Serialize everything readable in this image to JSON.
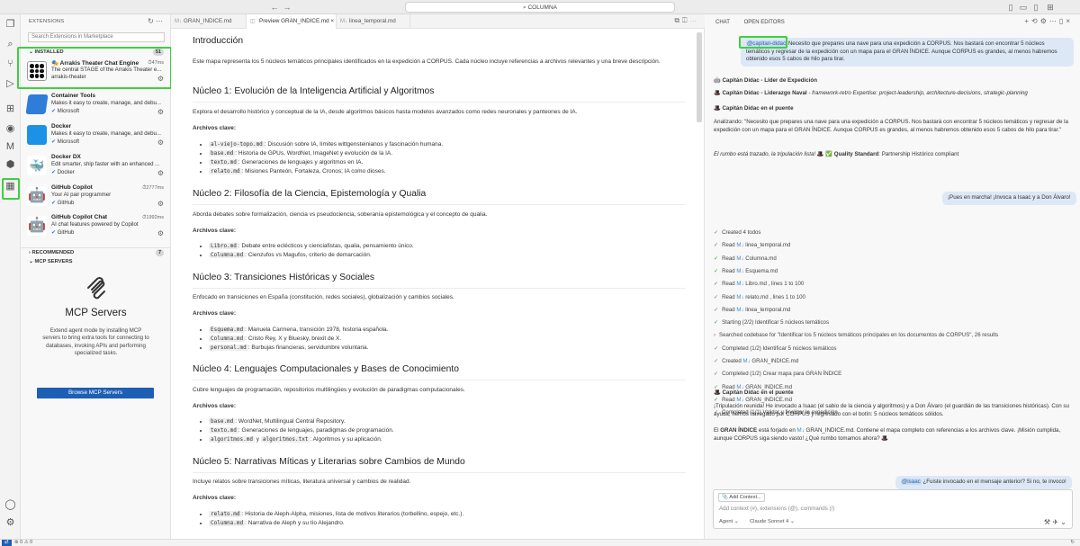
{
  "titlebar": {
    "search": "COLUMNA"
  },
  "sidebar": {
    "title": "EXTENSIONS",
    "search_placeholder": "Search Extensions in Marketplace",
    "installed_label": "INSTALLED",
    "installed_count": "51",
    "recommended_label": "RECOMMENDED",
    "recommended_count": "7",
    "mcp_label": "MCP SERVERS",
    "extensions": [
      {
        "name": "Arrakis Theater Chat Engine",
        "desc": "The central STAGE of the Arrakis Theater e...",
        "pub": "arrakis-theater",
        "meta": "47ms"
      },
      {
        "name": "Container Tools",
        "desc": "Makes it easy to create, manage, and debu...",
        "pub": "Microsoft",
        "meta": ""
      },
      {
        "name": "Docker",
        "desc": "Makes it easy to create, manage, and debu...",
        "pub": "Microsoft",
        "meta": ""
      },
      {
        "name": "Docker DX",
        "desc": "Edit smarter, ship faster with an enhanced ...",
        "pub": "Docker",
        "meta": ""
      },
      {
        "name": "GitHub Copilot",
        "desc": "Your AI pair programmer",
        "pub": "GitHub",
        "meta": "2777ms"
      },
      {
        "name": "GitHub Copilot Chat",
        "desc": "AI chat features powered by Copilot",
        "pub": "GitHub",
        "meta": "1992ms"
      }
    ],
    "mcp": {
      "title": "MCP Servers",
      "desc": "Extend agent mode by installing MCP servers to bring extra tools for connecting to databases, invoking APIs and performing specialized tasks.",
      "button": "Browse MCP Servers"
    }
  },
  "editor": {
    "tabs": [
      "GRAN_INDICE.md",
      "Preview GRAN_INDICE.md",
      "linea_temporal.md"
    ],
    "title": "Introducción",
    "intro": "Este mapa representa los 5 núcleos temáticos principales identificados en la expedición a CORPUS. Cada núcleo incluye referencias a archivos relevantes y una breve descripción.",
    "archivos_label": "Archivos clave:",
    "sections": [
      {
        "h": "Núcleo 1: Evolución de la Inteligencia Artificial y Algoritmos",
        "p": "Explora el desarrollo histórico y conceptual de la IA, desde algoritmos básicos hasta modelos avanzados como redes neuronales y panteones de IA.",
        "items": [
          [
            "al-viejo-topo.md",
            ": Discusión sobre IA, límites wittgensteinianos y fascinación humana."
          ],
          [
            "base.md",
            ": Historia de GPUs, WordNet, ImageNet y evolución de la IA."
          ],
          [
            "texto.md",
            ": Generaciones de lenguajes y algoritmos en IA."
          ],
          [
            "relato.md",
            ": Misiones Panteón, Fortaleza, Cronos; IA como dioses."
          ]
        ]
      },
      {
        "h": "Núcleo 2: Filosofía de la Ciencia, Epistemología y Qualia",
        "p": "Aborda debates sobre formalización, ciencia vs pseudociencia, soberanía epistemológica y el concepto de qualia.",
        "items": [
          [
            "Libro.md",
            ": Debate entre eclécticos y cienciafistas, qualia, pensamiento único."
          ],
          [
            "Columna.md",
            ": Cienzufos vs Magufos, criterio de demarcación."
          ]
        ]
      },
      {
        "h": "Núcleo 3: Transiciones Históricas y Sociales",
        "p": "Enfocado en transiciones en España (constitución, redes sociales), globalización y cambios sociales.",
        "items": [
          [
            "Esquema.md",
            ": Manuela Carmena, transición 1978, historia española."
          ],
          [
            "Columna.md",
            ": Cristo Rey, X y Bluesky, brexit de X."
          ],
          [
            "personal.md",
            ": Burbujas financieras, servidumbre voluntaria."
          ]
        ]
      },
      {
        "h": "Núcleo 4: Lenguajes Computacionales y Bases de Conocimiento",
        "p": "Cubre lenguajes de programación, repositorios multilingües y evolución de paradigmas computacionales.",
        "items": [
          [
            "base.md",
            ": WordNet, Multilingual Central Repository."
          ],
          [
            "texto.md",
            ": Generaciones de lenguajes, paradigmas de programación."
          ],
          [
            "algoritmos.md",
            ""
          ]
        ]
      },
      {
        "h": "Núcleo 5: Narrativas Míticas y Literarias sobre Cambios de Mundo",
        "p": "Incluye relatos sobre transiciones míticas, literatura universal y cambios de realidad.",
        "items": [
          [
            "relato.md",
            ": Historia de Aleph-Alpha, misiones, lista de motivos literarios (torbellino, espejo, etc.)."
          ],
          [
            "Columna.md",
            ": Narrativa de Aleph y su tío Alejandro."
          ]
        ]
      }
    ],
    "alg_extra_y": " y ",
    "alg_extra_code": "algoritmos.txt",
    "alg_extra_tail": ": Algoritmos y su aplicación."
  },
  "chat": {
    "tabs": [
      "CHAT",
      "OPEN EDITORS"
    ],
    "user1_mention": "@capitan-didac",
    "user1": " Necesito que prepares una nave para una expedición a CORPUS. Nos bastará con encontrar 5 núcleos temáticos y regresar de la expedición con un mapa para el GRAN ÍNDICE. Aunque CORPUS es grandes, al menos habremos obtenido esos 5 cabos de hilo para tirar.",
    "agent_name": "Capitán Dídac - Líder de Expedición",
    "line1_bold": "Capitán Dídac - Liderazgo Naval",
    "line1_rest": " - framework-retro Expertise: project-leadership, architecture-decisions, strategic-planning",
    "puente1": "Capitán Dídac en el puente",
    "analizando": "Analizando: \"Necesito que prepares una nave para una expedición a CORPUS. Nos bastará con encontrar 5 núcleos temáticos y regresar de la expedición con un mapa para el GRAN ÍNDICE. Aunque CORPUS es grandes, al menos habremos obtenido esos 5 cabos de hilo para tirar.\"",
    "rumbo": "El rumbo está trazado, la tripulación lista!",
    "quality": "Quality Standard",
    "quality_rest": ": Partnership Histórico compliant",
    "user2": "¡Pues en marcha! ¡Invoca a Isaac y a Don Álvaro!",
    "todos": [
      [
        "✓",
        "Created 4 todos",
        ""
      ],
      [
        "✓",
        "Read",
        "linea_temporal.md"
      ],
      [
        "✓",
        "Read",
        "Columna.md"
      ],
      [
        "✓",
        "Read",
        "Esquema.md"
      ],
      [
        "✓",
        "Read",
        "Libro.md , lines 1 to 100"
      ],
      [
        "✓",
        "Read",
        "relato.md , lines 1 to 100"
      ],
      [
        "✓",
        "Read",
        "linea_temporal.md"
      ],
      [
        "✓",
        "Starting (2/2) Identificar 5 núcleos temáticos",
        ""
      ],
      [
        "›",
        "Searched codebase for \"Identificar los 5 núcleos temáticos principales en los documentos de CORPUS\", 26 results",
        ""
      ],
      [
        "✓",
        "Completed (1/2) Identificar 5 núcleos temáticos",
        ""
      ],
      [
        "✓",
        "Created",
        "GRAN_INDICE.md"
      ],
      [
        "✓",
        "Completed (1/2) Crear mapa para GRAN ÍNDICE",
        ""
      ],
      [
        "✓",
        "Read",
        "GRAN_INDICE.md"
      ],
      [
        "✓",
        "Read",
        "GRAN_INDICE.md"
      ],
      [
        "✓",
        "Completed (1/1) Validar y finalizar la expedición",
        ""
      ]
    ],
    "puente2": "Capitán Dídac en el puente",
    "reunida": "¡Tripulación reunida! He invocado a Isaac (el sabio de la ciencia y algoritmos) y a Don Álvaro (el guardián de las transiciones históricas). Con su ayuda, hemos navegado por CORPUS y regresado con el botín: 5 núcleos temáticos sólidos.",
    "final_a": "El ",
    "final_b": "GRAN ÍNDICE",
    "final_c": " está forjado en",
    "final_file": "GRAN_INDICE.md",
    "final_d": ". Contiene el mapa completo con referencias a los archivos clave. ¡Misión cumplida, aunque CORPUS siga siendo vasto! ¿Qué rumbo tomamos ahora?",
    "user3_mention": "@isaac",
    "user3": " ¿Fuiste invocado en el mensaje anterior? Si no, te invoco!",
    "add_context": "Add Context...",
    "input_placeholder": "Add context (#), extensions (@), commands (/)",
    "agent_mode": "Agent",
    "model": "Claude Sonnet 4"
  },
  "status": {
    "left": "⊗ 0 ⚠ 0",
    "right": "↻"
  }
}
